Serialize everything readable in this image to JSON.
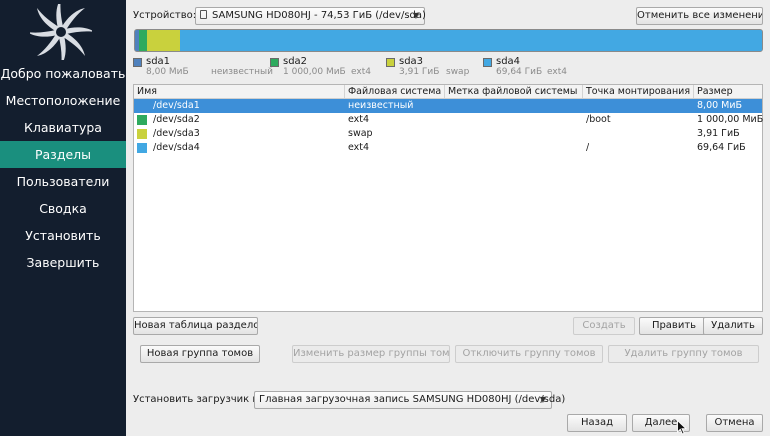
{
  "sidebar": {
    "steps": [
      {
        "label": "Добро пожаловать"
      },
      {
        "label": "Местоположение"
      },
      {
        "label": "Клавиатура"
      },
      {
        "label": "Разделы",
        "active": true
      },
      {
        "label": "Пользователи"
      },
      {
        "label": "Сводка"
      },
      {
        "label": "Установить"
      },
      {
        "label": "Завершить"
      }
    ]
  },
  "device": {
    "label": "Устройство:",
    "value": "SAMSUNG HD080HJ - 74,53 ГиБ (/dev/sda)",
    "icon": "disk-icon"
  },
  "revert_button": "Отменить все изменения",
  "partition_bar": {
    "segments": [
      {
        "name": "sda1",
        "size_mib": 8,
        "color": "#4f81bd"
      },
      {
        "name": "sda2",
        "size_mib": 1000,
        "color": "#2eaa5e"
      },
      {
        "name": "sda3",
        "size_mib": 4003.84,
        "color": "#c9d13d"
      },
      {
        "name": "sda4",
        "size_mib": 71311.36,
        "color": "#42a8e3"
      }
    ]
  },
  "legend": [
    {
      "name": "sda1",
      "size": "8,00 МиБ",
      "fs": "неизвестный",
      "color": "#4f81bd"
    },
    {
      "name": "sda2",
      "size": "1 000,00 МиБ",
      "fs": "ext4",
      "color": "#2eaa5e"
    },
    {
      "name": "sda3",
      "size": "3,91 ГиБ",
      "fs": "swap",
      "color": "#c9d13d"
    },
    {
      "name": "sda4",
      "size": "69,64 ГиБ",
      "fs": "ext4",
      "color": "#42a8e3"
    }
  ],
  "table": {
    "headers": {
      "name": "Имя",
      "fs": "Файловая система",
      "label": "Метка файловой системы",
      "mount": "Точка монтирования",
      "size": "Размер"
    },
    "rows": [
      {
        "name": "/dev/sda1",
        "fs": "неизвестный",
        "label": "",
        "mount": "",
        "size": "8,00 МиБ",
        "color": "#3d8fd8",
        "selected": true
      },
      {
        "name": "/dev/sda2",
        "fs": "ext4",
        "label": "",
        "mount": "/boot",
        "size": "1 000,00 МиБ",
        "color": "#2eaa5e"
      },
      {
        "name": "/dev/sda3",
        "fs": "swap",
        "label": "",
        "mount": "",
        "size": "3,91 ГиБ",
        "color": "#c9d13d"
      },
      {
        "name": "/dev/sda4",
        "fs": "ext4",
        "label": "",
        "mount": "/",
        "size": "69,64 ГиБ",
        "color": "#42a8e3"
      }
    ]
  },
  "buttons": {
    "new_table": "Новая таблица разделов",
    "create": "Создать",
    "edit": "Править",
    "delete": "Удалить",
    "new_group": "Новая группа томов",
    "resize_group": "Изменить размер группы томов",
    "deactivate_group": "Отключить группу томов",
    "remove_group": "Удалить группу томов",
    "back": "Назад",
    "next": "Далее",
    "cancel": "Отмена"
  },
  "bootloader": {
    "label": "Установить загрузчик в:",
    "value": "Главная загрузочная запись SAMSUNG HD080HJ (/dev/sda)"
  }
}
